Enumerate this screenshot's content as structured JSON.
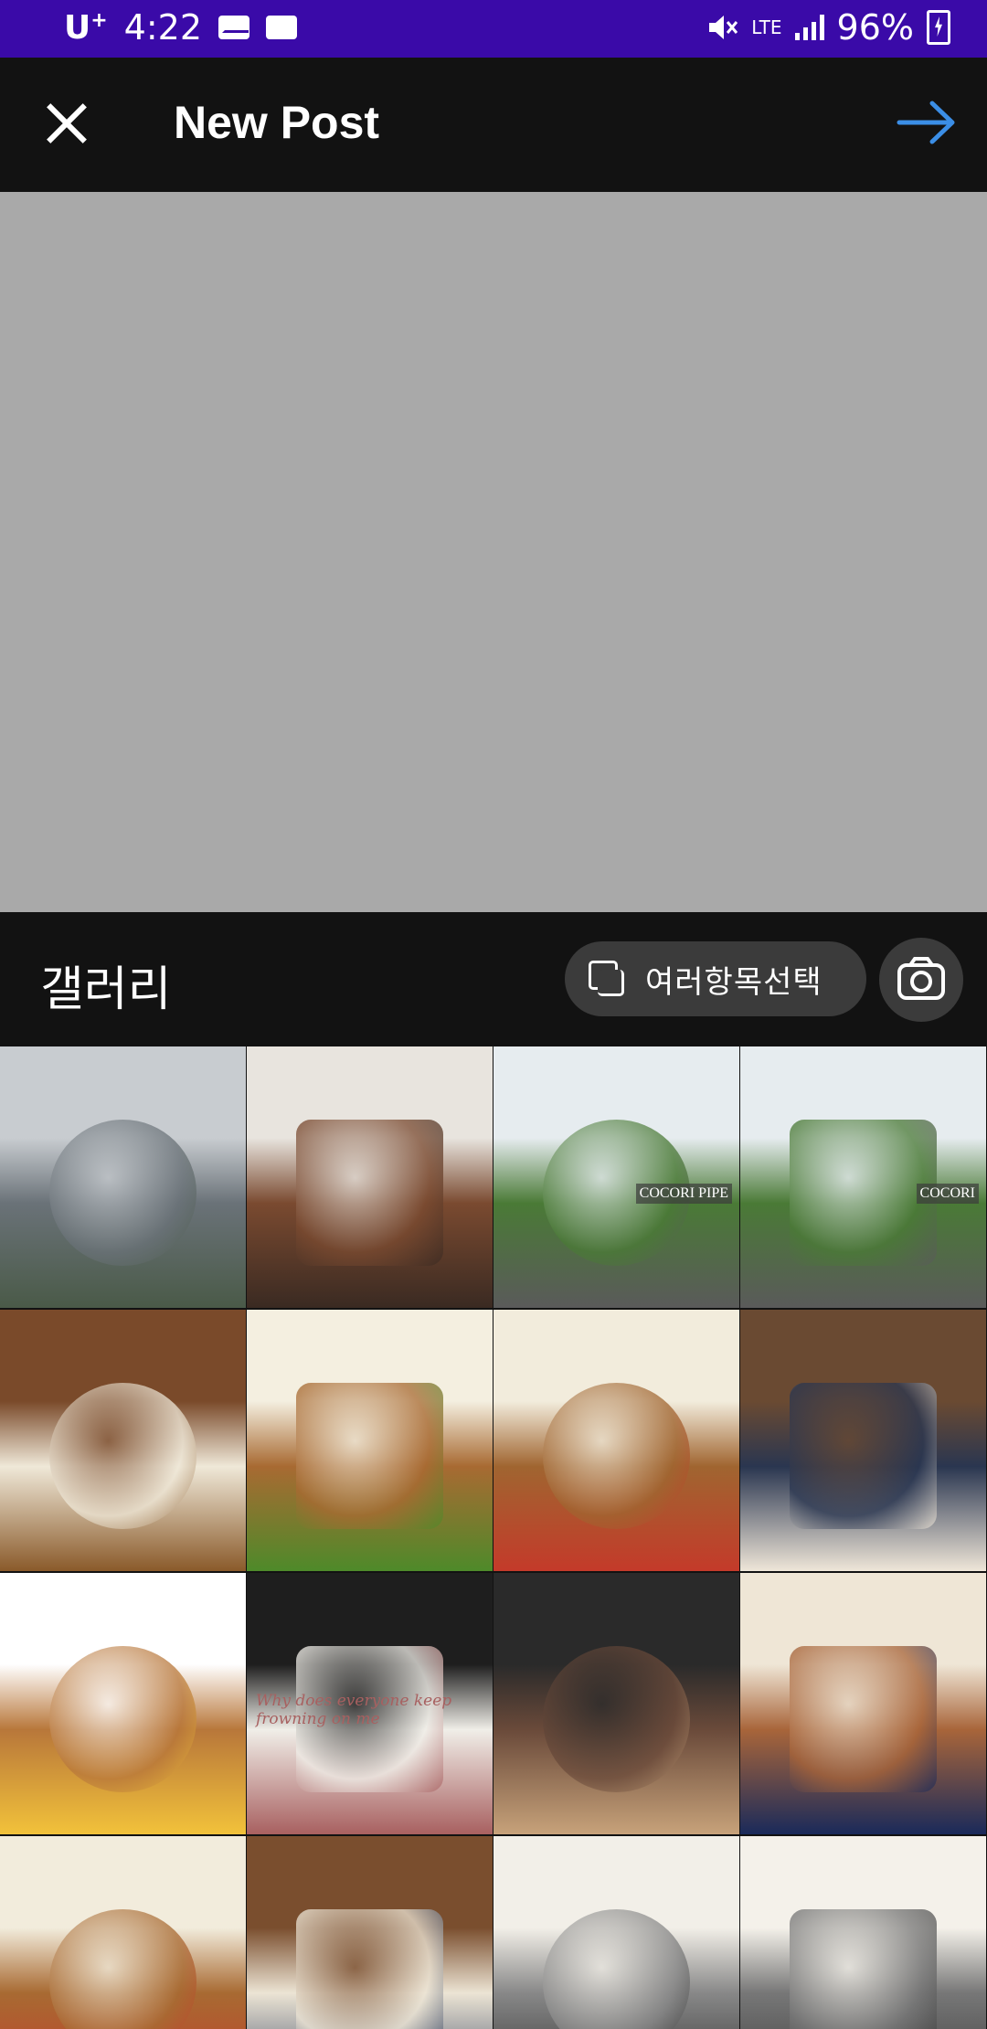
{
  "status_bar": {
    "carrier": "U",
    "carrier_sup": "+",
    "time": "4:22",
    "network": "LTE",
    "battery": "96%",
    "colors": {
      "bg": "#3a0aa8"
    }
  },
  "app_bar": {
    "title": "New Post",
    "close_icon": "close-icon",
    "next_icon": "arrow-right-icon",
    "accent": "#3b8ee6"
  },
  "gallery": {
    "title": "갤러리",
    "multi_select_label": "여러항목선택",
    "camera_icon": "camera-icon",
    "thumbnails": [
      {
        "name": "sea-coast",
        "colors": [
          "#c8ccd0",
          "#6a7278",
          "#4a5a48"
        ]
      },
      {
        "name": "chocolate-cake",
        "colors": [
          "#e8e4de",
          "#7a4a30",
          "#3a2a22"
        ]
      },
      {
        "name": "cocori-pipe-garden-1",
        "colors": [
          "#e6ecef",
          "#4a7a36",
          "#5a5a5a"
        ],
        "sign": "COCORI PIPE"
      },
      {
        "name": "cocori-pipe-garden-2",
        "colors": [
          "#e6ecef",
          "#4a7a36",
          "#5a5a5a"
        ],
        "sign": "COCORI"
      },
      {
        "name": "pasta-dish-table",
        "colors": [
          "#7a4a2a",
          "#efe8d8",
          "#8a5a2a"
        ]
      },
      {
        "name": "chicken-plate-1",
        "colors": [
          "#f4efe0",
          "#a86a32",
          "#4e8a2a"
        ]
      },
      {
        "name": "chicken-plate-2",
        "colors": [
          "#f2ecdc",
          "#a06530",
          "#c43a2a"
        ]
      },
      {
        "name": "table-with-person",
        "colors": [
          "#6a4a32",
          "#2a3650",
          "#efe6d8"
        ]
      },
      {
        "name": "burger",
        "colors": [
          "#ffffff",
          "#b8773a",
          "#f2c23a"
        ]
      },
      {
        "name": "laptop-note",
        "colors": [
          "#1e1e1e",
          "#f0eee8",
          "#a86060"
        ],
        "note": "Why does everyone keep frowning on me"
      },
      {
        "name": "chocolates-bowl",
        "colors": [
          "#2a2a2a",
          "#6a4a3a",
          "#c7a27a"
        ]
      },
      {
        "name": "chicken-plate-3",
        "colors": [
          "#efe6d6",
          "#a8653a",
          "#1a2a5a"
        ]
      },
      {
        "name": "chicken-plate-4",
        "colors": [
          "#f2ecdc",
          "#a86a32",
          "#c43a2a"
        ]
      },
      {
        "name": "restaurant-table",
        "colors": [
          "#7a4e2e",
          "#ece4d4",
          "#2a3a5a"
        ]
      },
      {
        "name": "notebook-page-1",
        "colors": [
          "#f2efe8",
          "#888888",
          "#2a2a2a"
        ]
      },
      {
        "name": "notebook-page-2",
        "colors": [
          "#f4f1ea",
          "#777777",
          "#3a3a3a"
        ]
      }
    ]
  }
}
